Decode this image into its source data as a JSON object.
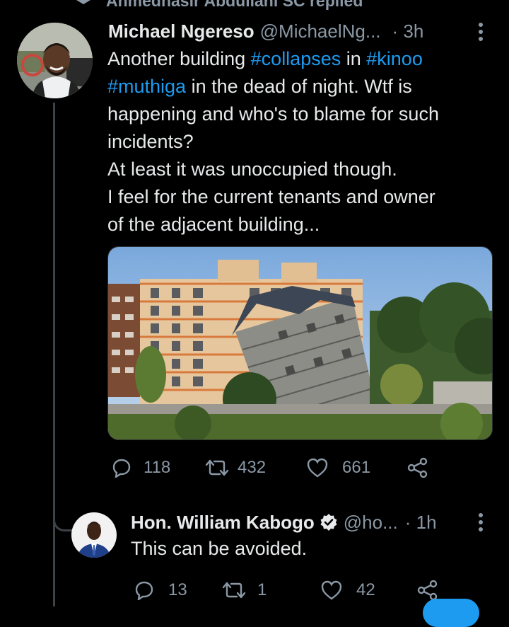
{
  "social_context": "Ahmednasir Abdullahi SC replied",
  "main_tweet": {
    "name": "Michael Ngereso",
    "handle": "@MichaelNg...",
    "time": "· 3h",
    "text_parts": [
      {
        "text": "Another building ",
        "type": "text"
      },
      {
        "text": "#collapses",
        "type": "hashtag"
      },
      {
        "text": " in ",
        "type": "text"
      },
      {
        "text": "#kinoo",
        "type": "hashtag"
      },
      {
        "text": "\n",
        "type": "text"
      },
      {
        "text": "#muthiga",
        "type": "hashtag"
      },
      {
        "text": " in the dead of night. Wtf is\nhappening and who's to blame for such\nincidents?\nAt least it was unoccupied though.\nI feel for the current tenants and owner\nof the adjacent building...",
        "type": "text"
      }
    ],
    "replies": "118",
    "retweets": "432",
    "likes": "661"
  },
  "reply_tweet": {
    "name": "Hon. William Kabogo",
    "verified": true,
    "handle": "@ho...",
    "time": "· 1h",
    "text": "This can be avoided.",
    "replies": "13",
    "retweets": "1",
    "likes": "42"
  },
  "colors": {
    "background": "#000000",
    "hashtag": "#1d9bf0",
    "secondary_text": "#8b98a5"
  },
  "icons": [
    "retweet-icon",
    "more-icon",
    "reply-icon",
    "like-icon",
    "share-icon",
    "verified-icon"
  ]
}
